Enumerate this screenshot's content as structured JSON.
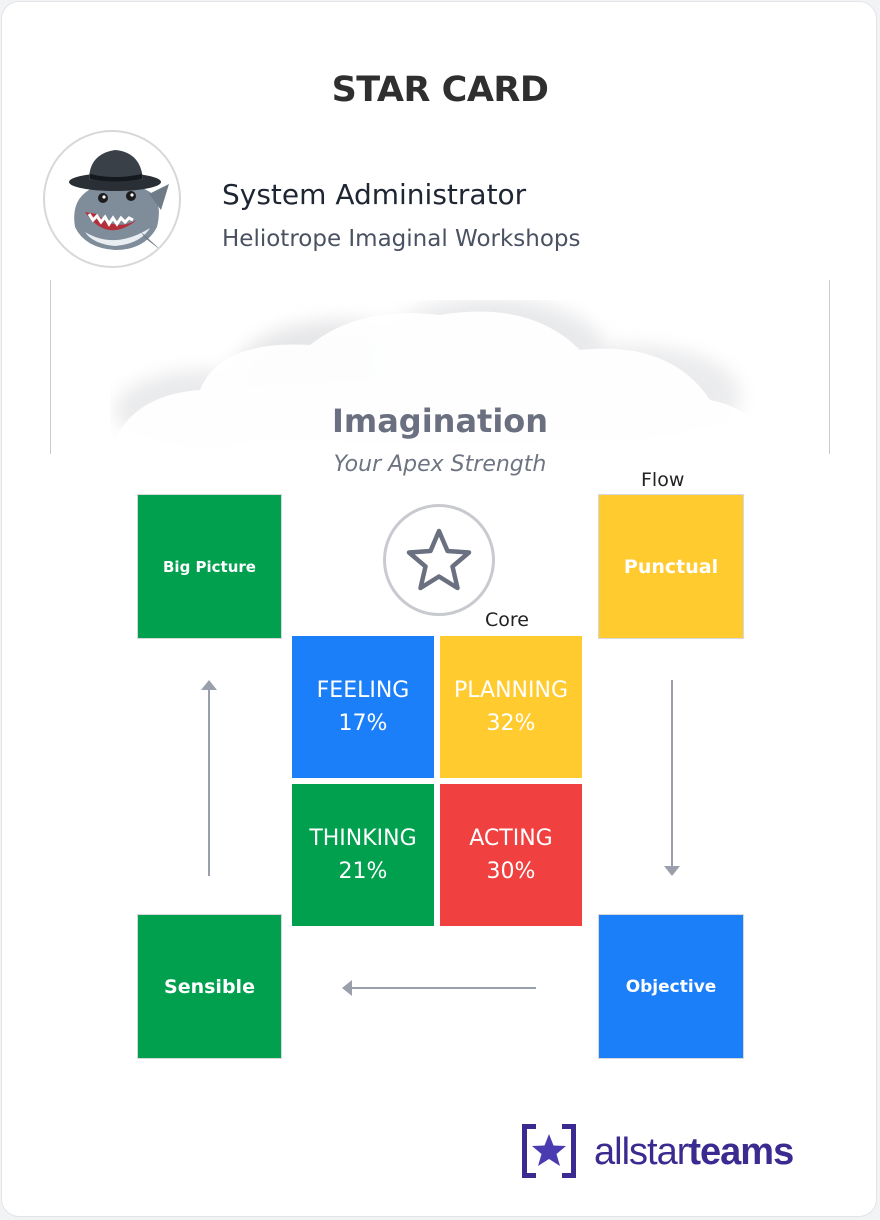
{
  "card": {
    "title": "STAR CARD",
    "profile": {
      "name": "System Administrator",
      "organization": "Heliotrope Imaginal Workshops",
      "avatar_icon": "shark-with-fedora-avatar"
    },
    "apex": {
      "title": "Imagination",
      "subtitle": "Your Apex Strength"
    },
    "flow": {
      "label": "Flow",
      "items": [
        {
          "position": "top-left",
          "label": "Big Picture",
          "color": "#00a04f"
        },
        {
          "position": "top-right",
          "label": "Punctual",
          "color": "#ffcb2f"
        },
        {
          "position": "bottom-left",
          "label": "Sensible",
          "color": "#00a04f"
        },
        {
          "position": "bottom-right",
          "label": "Objective",
          "color": "#1a7ff9"
        }
      ]
    },
    "core": {
      "label": "Core",
      "quadrants": [
        {
          "name": "FEELING",
          "percent": "17%",
          "color": "#1a7ff9"
        },
        {
          "name": "PLANNING",
          "percent": "32%",
          "color": "#ffcb2f"
        },
        {
          "name": "THINKING",
          "percent": "21%",
          "color": "#00a04f"
        },
        {
          "name": "ACTING",
          "percent": "30%",
          "color": "#f04040"
        }
      ]
    },
    "star_icon": "star-outline-icon",
    "brand": {
      "logo_icon": "allstarteams-logo-icon",
      "name_light": "allstar",
      "name_bold": "teams"
    }
  }
}
